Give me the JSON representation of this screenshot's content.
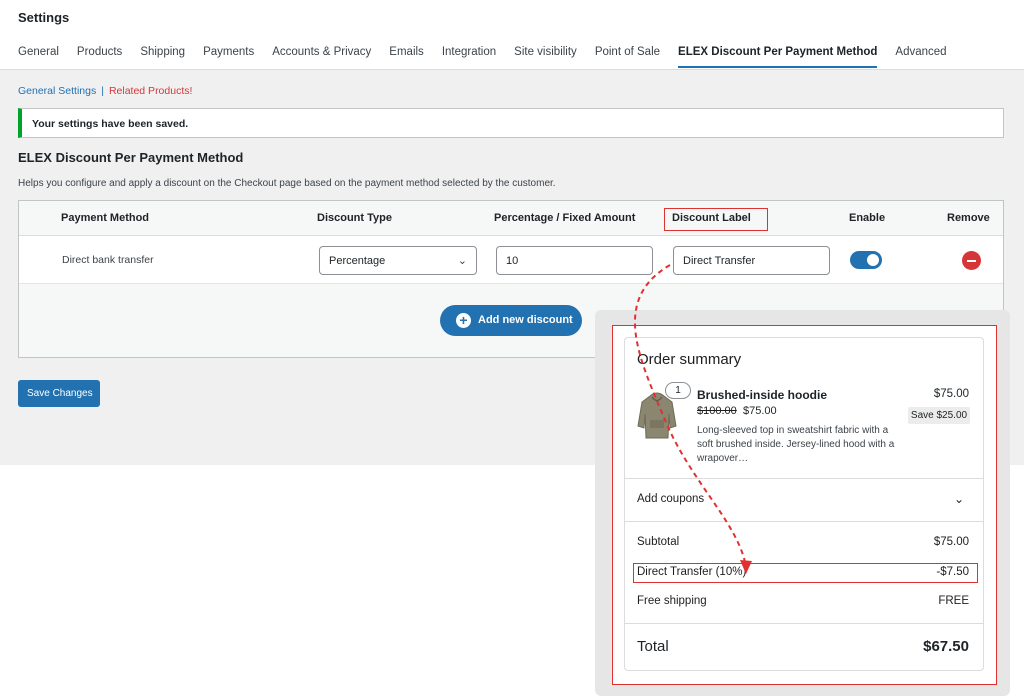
{
  "header": {
    "title": "Settings"
  },
  "tabs": [
    {
      "label": "General"
    },
    {
      "label": "Products"
    },
    {
      "label": "Shipping"
    },
    {
      "label": "Payments"
    },
    {
      "label": "Accounts & Privacy"
    },
    {
      "label": "Emails"
    },
    {
      "label": "Integration"
    },
    {
      "label": "Site visibility"
    },
    {
      "label": "Point of Sale"
    },
    {
      "label": "ELEX Discount Per Payment Method",
      "active": true
    },
    {
      "label": "Advanced"
    }
  ],
  "subnav": {
    "general": "General Settings",
    "separator": "|",
    "related": "Related Products!"
  },
  "notice": "Your settings have been saved.",
  "section": {
    "title": "ELEX Discount Per Payment Method",
    "description": "Helps you configure and apply a discount on the Checkout page based on the payment method selected by the customer."
  },
  "table": {
    "headers": {
      "payment_method": "Payment Method",
      "discount_type": "Discount Type",
      "amount": "Percentage / Fixed Amount",
      "label": "Discount Label",
      "enable": "Enable",
      "remove": "Remove"
    },
    "rows": [
      {
        "payment_method": "Direct bank transfer",
        "discount_type": "Percentage",
        "amount": "10",
        "label": "Direct Transfer",
        "enabled": true
      }
    ]
  },
  "buttons": {
    "add_new": "Add new discount",
    "save": "Save Changes"
  },
  "order_summary": {
    "title": "Order summary",
    "product": {
      "quantity": "1",
      "name": "Brushed-inside hoodie",
      "old_price": "$100.00",
      "new_price": "$75.00",
      "description": "Long-sleeved top in sweatshirt fabric with a soft brushed inside. Jersey-lined hood with a wrapover…",
      "price": "$75.00",
      "save": "Save $25.00"
    },
    "coupons_label": "Add coupons",
    "subtotal_label": "Subtotal",
    "subtotal_value": "$75.00",
    "discount_label": "Direct Transfer (10%)",
    "discount_value": "-$7.50",
    "shipping_label": "Free shipping",
    "shipping_value": "FREE",
    "total_label": "Total",
    "total_value": "$67.50"
  },
  "colors": {
    "accent": "#2271b1",
    "highlight": "#e03131",
    "notice_border": "#00a32a"
  }
}
